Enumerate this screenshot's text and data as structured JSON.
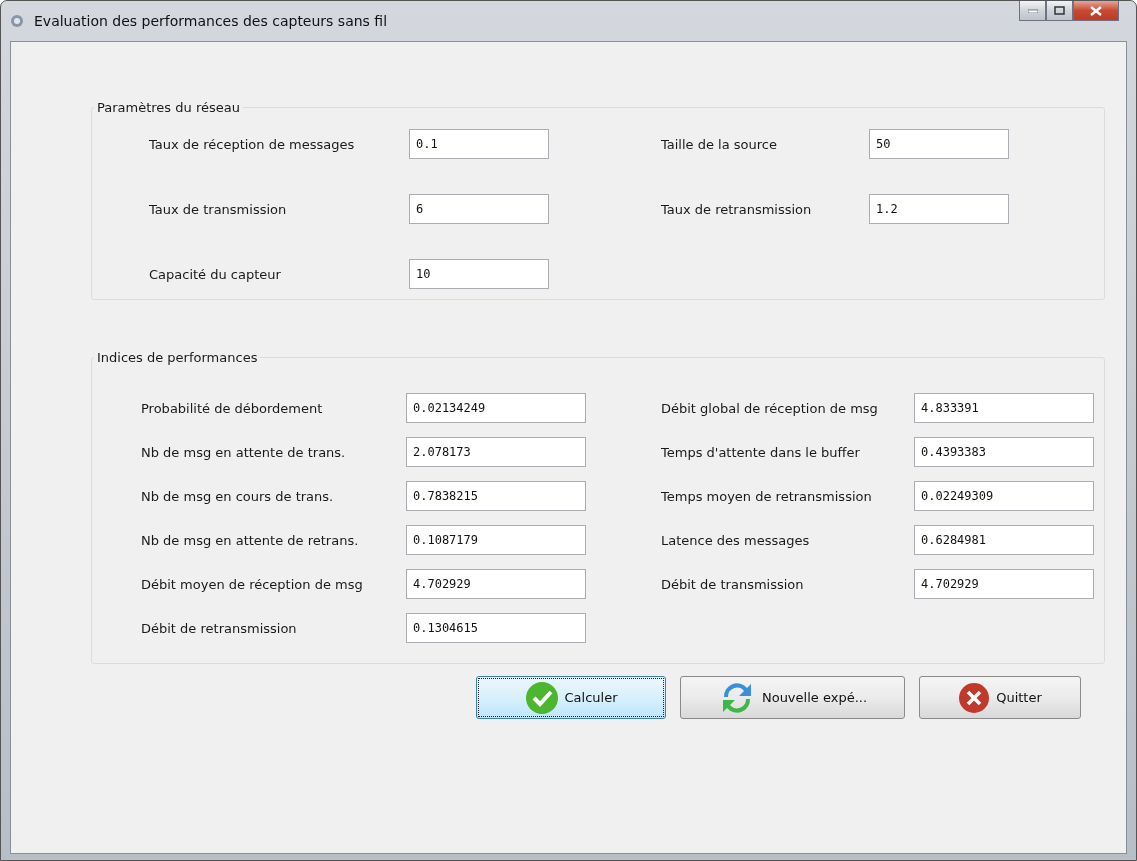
{
  "window": {
    "title": "Evaluation des performances des capteurs sans fil"
  },
  "groups": [
    {
      "title": "Paramètres du réseau",
      "kind": "params",
      "fields": [
        {
          "label": "Taux de réception de messages",
          "value": "0.1"
        },
        {
          "label": "Taille de la source",
          "value": "50"
        },
        {
          "label": "Taux de transmission",
          "value": "6"
        },
        {
          "label": "Taux de retransmission",
          "value": "1.2"
        },
        {
          "label": "Capacité du capteur",
          "value": "10"
        }
      ]
    },
    {
      "title": "Indices de performances",
      "kind": "results",
      "fields": [
        {
          "label": "Probabilité de débordement",
          "value": "0.02134249"
        },
        {
          "label": "Débit global de réception de msg",
          "value": "4.833391"
        },
        {
          "label": "Nb de msg en attente de trans.",
          "value": "2.078173"
        },
        {
          "label": "Temps d'attente dans le buffer",
          "value": "0.4393383"
        },
        {
          "label": "Nb de msg en cours de trans.",
          "value": "0.7838215"
        },
        {
          "label": "Temps moyen de retransmission",
          "value": "0.02249309"
        },
        {
          "label": "Nb de msg en attente de retrans.",
          "value": "0.1087179"
        },
        {
          "label": "Latence des messages",
          "value": "0.6284981"
        },
        {
          "label": "Débit moyen de réception de msg",
          "value": "4.702929"
        },
        {
          "label": "Débit de transmission",
          "value": "4.702929"
        },
        {
          "label": "Débit de retransmission",
          "value": "0.1304615"
        }
      ]
    }
  ],
  "buttons": [
    {
      "label": "Calculer",
      "kind": "check",
      "focused": true
    },
    {
      "label": "Nouvelle expé...",
      "kind": "refresh",
      "focused": false
    },
    {
      "label": "Quitter",
      "kind": "quit",
      "focused": false
    }
  ]
}
